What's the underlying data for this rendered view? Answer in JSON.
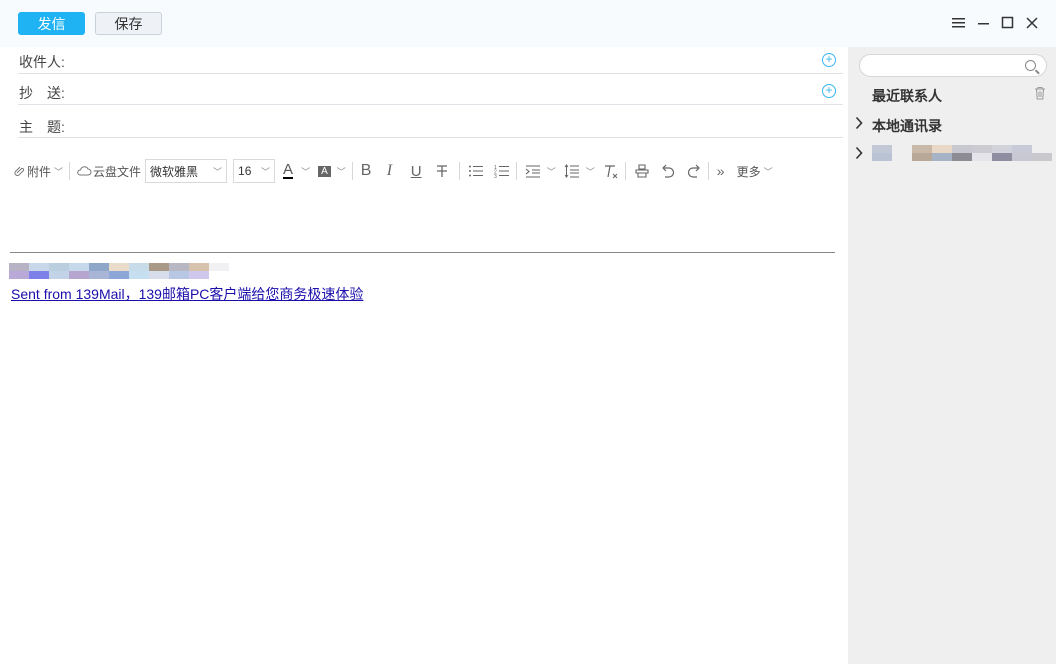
{
  "toolbar_top": {
    "send_label": "发信",
    "save_label": "保存"
  },
  "fields": {
    "to_label": "收件人:",
    "cc_label": "抄　送:",
    "subject_label": "主　题:"
  },
  "editor_toolbar": {
    "attach_label": "附件",
    "cloud_label": "云盘文件",
    "font_family": "微软雅黑",
    "font_size": "16",
    "more_label": "更多"
  },
  "body": {
    "signature_link": "Sent from 139Mail，139邮箱PC客户端给您商务极速体验"
  },
  "sidebar": {
    "search_placeholder": "",
    "recent_label": "最近联系人",
    "local_label": "本地通讯录"
  },
  "colors": {
    "send_button": "#1fb3f3",
    "accent_add": "#39b5ee",
    "link": "#1a0dab",
    "sidebar_bg": "#efefef"
  }
}
